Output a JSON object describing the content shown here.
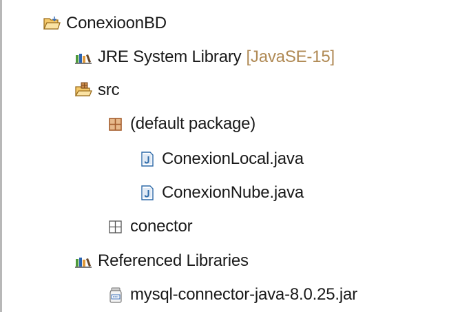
{
  "project_tree": {
    "project": {
      "name": "ConexioonBD",
      "icon": "open-project-folder-icon"
    },
    "jre_library": {
      "label": "JRE System Library",
      "decoration": "[JavaSE-15]",
      "icon": "library-icon"
    },
    "src_folder": {
      "label": "src",
      "icon": "source-folder-icon"
    },
    "default_package": {
      "label": "(default package)",
      "icon": "package-icon"
    },
    "files": [
      {
        "label": "ConexionLocal.java",
        "icon": "java-file-icon"
      },
      {
        "label": "ConexionNube.java",
        "icon": "java-file-icon"
      }
    ],
    "conector_package": {
      "label": "conector",
      "icon": "empty-package-icon"
    },
    "referenced_libraries": {
      "label": "Referenced Libraries",
      "icon": "library-icon"
    },
    "jar": {
      "label": "mysql-connector-java-8.0.25.jar",
      "icon": "jar-file-icon"
    }
  },
  "colors": {
    "decoration_text": "#b08a55",
    "folder_yellow": "#f5c96a",
    "folder_outline": "#9a6d1d",
    "package_brown": "#a55e2e",
    "java_file_blue": "#2e6aa8",
    "library_green": "#4e9a3a",
    "library_blue": "#2b63b1",
    "library_orange": "#e19a3a"
  }
}
